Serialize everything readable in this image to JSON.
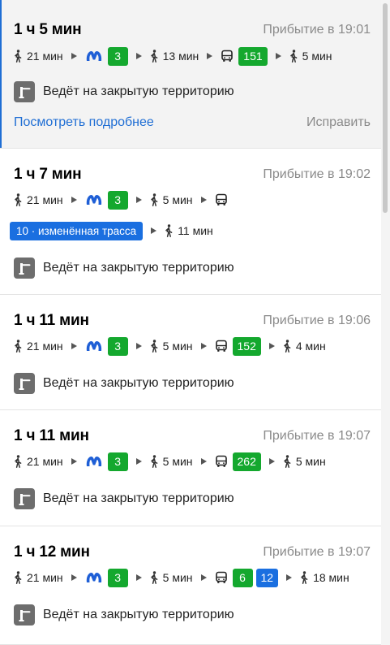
{
  "colors": {
    "metro_green": "#14a82e",
    "bus_green": "#14a82e",
    "bus_blue": "#1a6fe0",
    "link_blue": "#1f6ed4"
  },
  "icons": {
    "walk": "pedestrian-icon",
    "metro": "metro-spb-icon",
    "bus": "bus-icon",
    "barrier": "barrier-gate-icon"
  },
  "common": {
    "warning": "Ведёт на закрытую территорию"
  },
  "routes": [
    {
      "duration": "1 ч 5 мин",
      "arrival": "Прибытие в 19:01",
      "walk1": "21 мин",
      "metro_line": "3",
      "walk2": "13 мин",
      "buses": [
        "151"
      ],
      "walk3": "5 мин",
      "details_link": "Посмотреть подробнее",
      "fix_link": "Исправить"
    },
    {
      "duration": "1 ч 7 мин",
      "arrival": "Прибытие в 19:02",
      "walk1": "21 мин",
      "metro_line": "3",
      "walk2": "5 мин",
      "buses": [
        "10 · изменённая трасса"
      ],
      "walk3": "11 мин"
    },
    {
      "duration": "1 ч 11 мин",
      "arrival": "Прибытие в 19:06",
      "walk1": "21 мин",
      "metro_line": "3",
      "walk2": "5 мин",
      "buses": [
        "152"
      ],
      "walk3": "4 мин"
    },
    {
      "duration": "1 ч 11 мин",
      "arrival": "Прибытие в 19:07",
      "walk1": "21 мин",
      "metro_line": "3",
      "walk2": "5 мин",
      "buses": [
        "262"
      ],
      "walk3": "5 мин"
    },
    {
      "duration": "1 ч 12 мин",
      "arrival": "Прибытие в 19:07",
      "walk1": "21 мин",
      "metro_line": "3",
      "walk2": "5 мин",
      "buses": [
        "6",
        "12"
      ],
      "walk3": "18 мин"
    }
  ]
}
